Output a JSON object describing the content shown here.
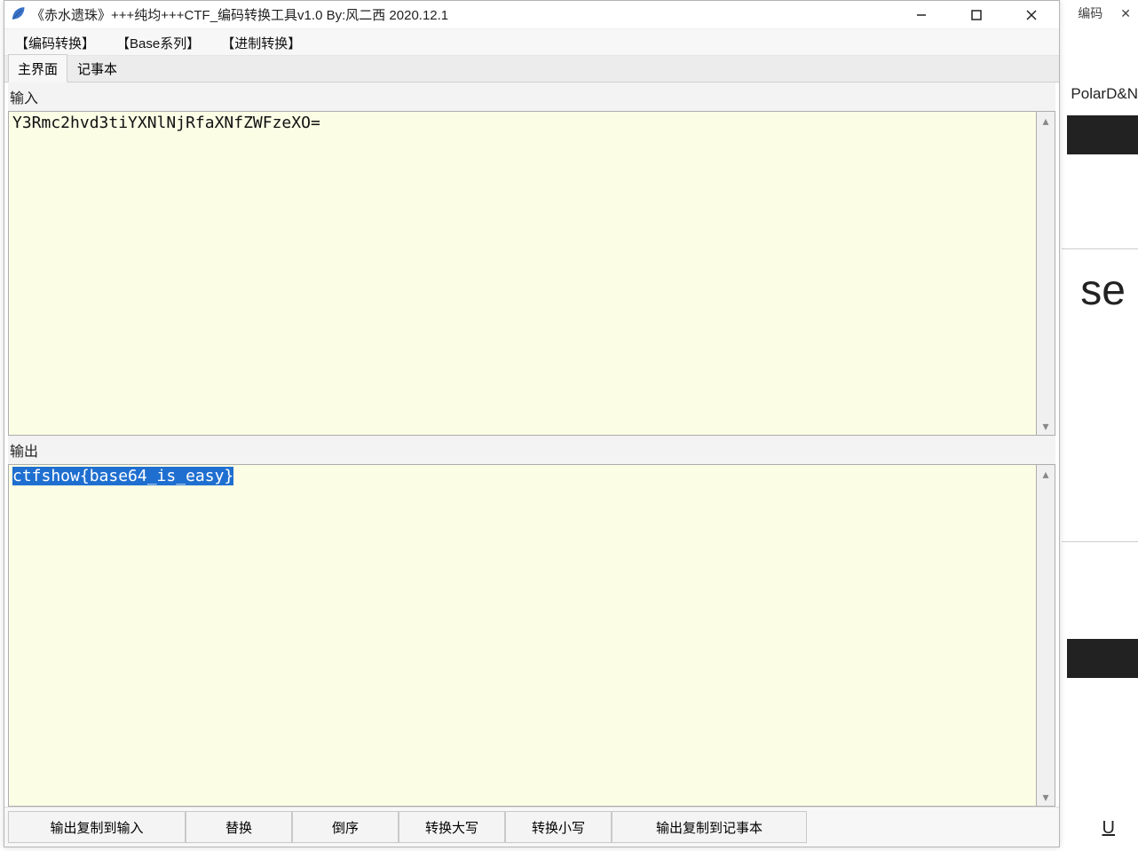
{
  "bg": {
    "topRightText": "编码",
    "polar": "PolarD&N",
    "se": "se",
    "u": "U"
  },
  "window": {
    "title": "《赤水遗珠》+++纯均+++CTF_编码转换工具v1.0   By:风二西 2020.12.1"
  },
  "menu": {
    "encode": "【编码转换】",
    "base": "【Base系列】",
    "radix": "【进制转换】"
  },
  "tabs": {
    "main": "主界面",
    "note": "记事本"
  },
  "labels": {
    "input": "输入",
    "output": "输出"
  },
  "input_text": "Y3Rmc2hvd3tiYXNlNjRfaXNfZWFzeXO=",
  "output_text": "ctfshow{base64_is_easy}",
  "buttons": {
    "copy_out_to_in": "输出复制到输入",
    "replace": "替换",
    "reverse": "倒序",
    "upper": "转换大写",
    "lower": "转换小写",
    "copy_out_to_note": "输出复制到记事本"
  }
}
